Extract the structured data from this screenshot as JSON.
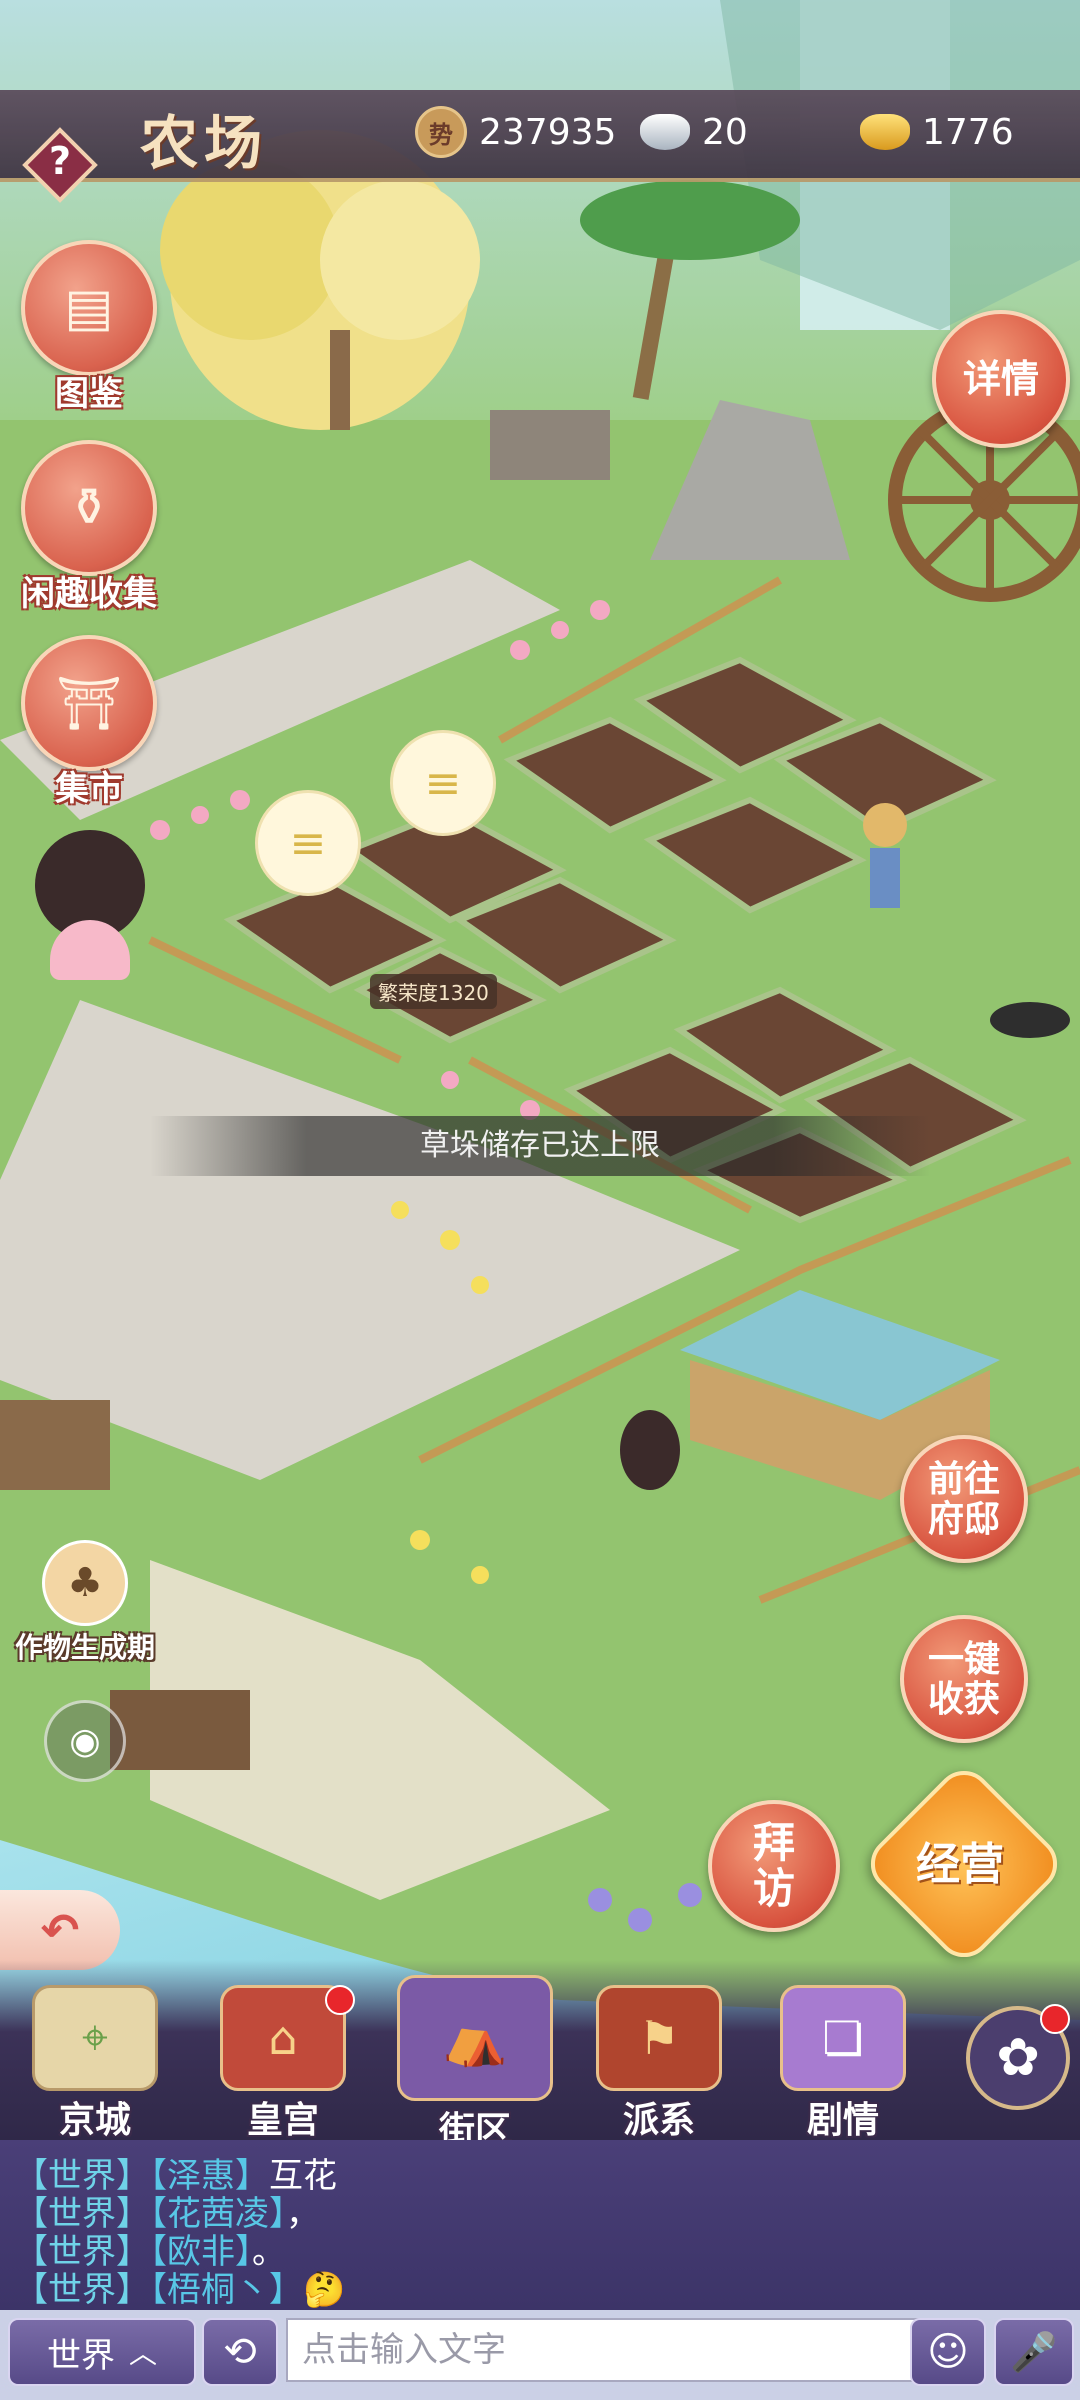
{
  "header": {
    "title": "农场",
    "help_symbol": "?",
    "currencies": [
      {
        "icon": "prestige-coin-icon",
        "glyph": "势",
        "value": "237935"
      },
      {
        "icon": "silver-ingot-icon",
        "value": "20"
      },
      {
        "icon": "gold-ingot-icon",
        "value": "1776"
      }
    ]
  },
  "left_menu": [
    {
      "label": "图鉴",
      "icon": "scrolls-icon"
    },
    {
      "label": "闲趣收集",
      "icon": "collection-jar-icon"
    },
    {
      "label": "集市",
      "icon": "market-gate-icon"
    }
  ],
  "details_button": "详情",
  "scene": {
    "prosperity_label": "繁荣度1320",
    "toast": "草垛储存已达上限",
    "crop_cycle_label": "作物生成期"
  },
  "action_buttons": {
    "go_mansion": "前往府邸",
    "harvest_all": "一键收获",
    "visit": "拜访",
    "manage": "经营"
  },
  "bottom_nav": [
    {
      "label": "京城",
      "icon": "map-icon",
      "badge": false
    },
    {
      "label": "皇宫",
      "icon": "palace-icon",
      "badge": true
    },
    {
      "label": "街区",
      "icon": "street-stall-icon",
      "badge": false
    },
    {
      "label": "派系",
      "icon": "faction-banner-icon",
      "badge": false
    },
    {
      "label": "剧情",
      "icon": "story-book-icon",
      "badge": false
    },
    {
      "label": "",
      "icon": "flower-menu-icon",
      "badge": true
    }
  ],
  "chat": {
    "messages": [
      {
        "channel": "【世界】",
        "name": "【泽惠】",
        "text": "互花"
      },
      {
        "channel": "【世界】",
        "name": "【花茜凌】",
        "text": "，"
      },
      {
        "channel": "【世界】",
        "name": "【欧非】",
        "text": "。"
      },
      {
        "channel": "【世界】",
        "name": "【梧桐丶】",
        "text": "🤔"
      }
    ],
    "channel_selector": "世界",
    "input_placeholder": "点击输入文字"
  },
  "colors": {
    "accent_red": "#d8533f",
    "chat_bg": "#4a3f78",
    "chat_name": "#58c7e6",
    "topbar": "#3e3342"
  }
}
